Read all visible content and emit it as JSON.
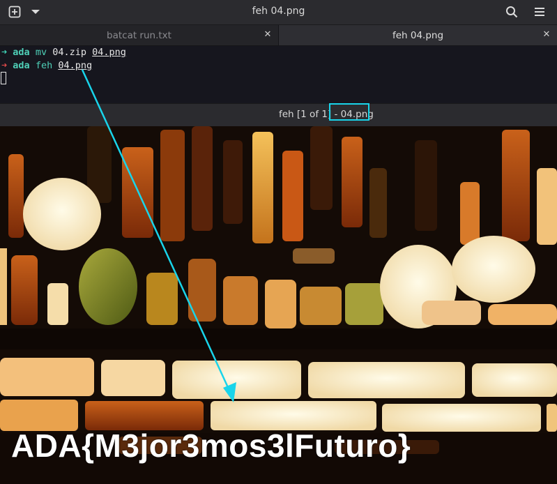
{
  "window": {
    "title": "feh 04.png"
  },
  "tabs": [
    {
      "label": "batcat run.txt",
      "active": false
    },
    {
      "label": "feh 04.png",
      "active": true
    }
  ],
  "terminal": {
    "line1": {
      "arrow": "➜",
      "user": "ada",
      "cmd": "mv",
      "arg1": "04.zip",
      "arg2": "04.png"
    },
    "line2": {
      "arrow": "➜",
      "user": "ada",
      "cmd": "feh",
      "arg1": "04.png"
    }
  },
  "feh": {
    "title_prefix": "feh [1 of 1] - ",
    "filename": "04.png"
  },
  "image": {
    "flag_text": "ADA{M3jor3mos3lFuturo}"
  },
  "colors": {
    "annotation": "#19d4ea",
    "ok_arrow": "#3fd1b5",
    "err_arrow": "#e04a4a"
  }
}
